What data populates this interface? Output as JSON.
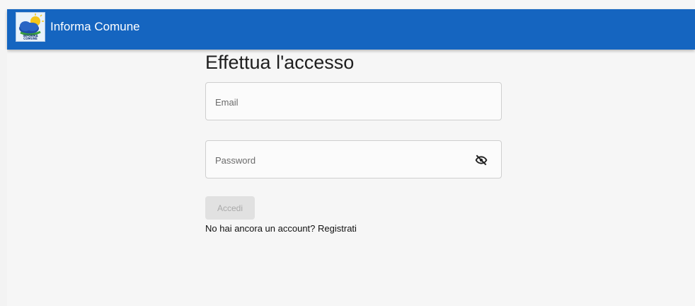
{
  "app": {
    "title": "Informa Comune",
    "logo_text": "INFORMA COMUNE",
    "brand_color": "#1565c0"
  },
  "login": {
    "heading": "Effettua l'accesso",
    "email_placeholder": "Email",
    "password_placeholder": "Password",
    "password_toggle_icon": "eye-off-icon",
    "submit_label": "Accedi",
    "register_prompt": "No hai ancora un account?",
    "register_link": "Registrati"
  }
}
